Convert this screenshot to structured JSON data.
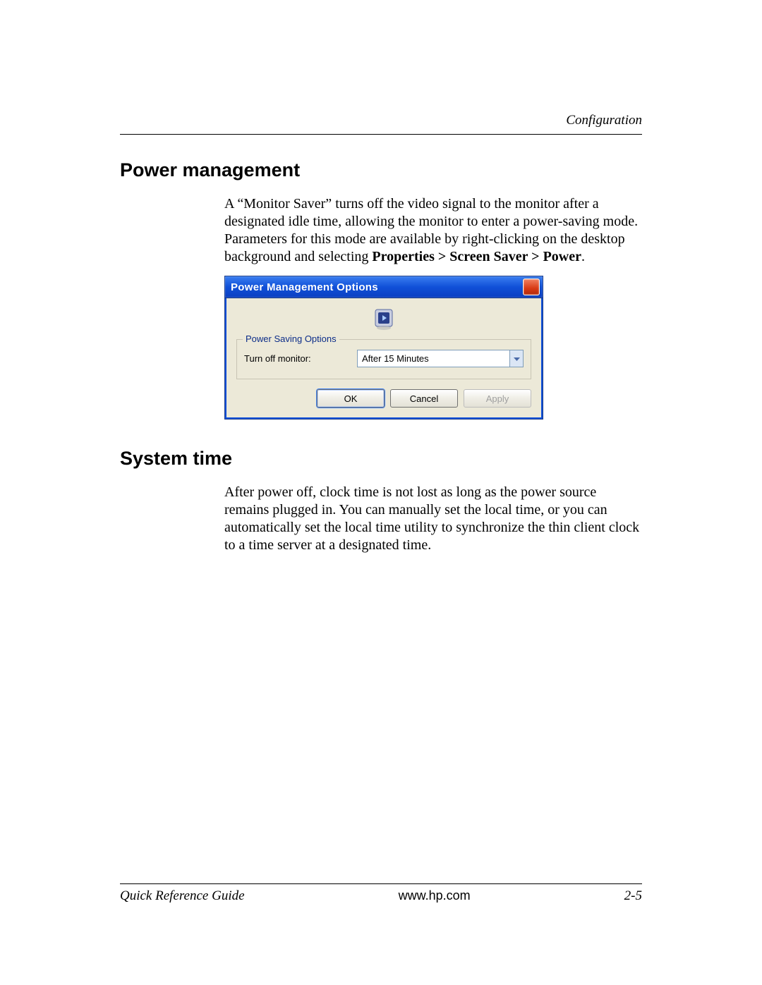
{
  "header": {
    "chapter": "Configuration"
  },
  "sections": {
    "power_mgmt": {
      "heading": "Power management",
      "para_main": "A “Monitor Saver” turns off the video signal to the monitor after a designated idle time, allowing the monitor to enter a power-saving mode. Parameters for this mode are available by right-clicking on the desktop background and selecting ",
      "para_bold": "Properties > Screen Saver > Power",
      "para_end": "."
    },
    "system_time": {
      "heading": "System time",
      "para": "After power off, clock time is not lost as long as the power source remains plugged in. You can manually set the local time, or you can automatically set the local time utility to synchronize the thin client clock to a time server at a designated time."
    }
  },
  "dialog": {
    "title": "Power Management Options",
    "group_legend": "Power Saving Options",
    "row_label": "Turn off monitor:",
    "combo_value": "After 15 Minutes",
    "buttons": {
      "ok": "OK",
      "cancel": "Cancel",
      "apply": "Apply"
    }
  },
  "footer": {
    "left": "Quick Reference Guide",
    "center": "www.hp.com",
    "right": "2-5"
  }
}
